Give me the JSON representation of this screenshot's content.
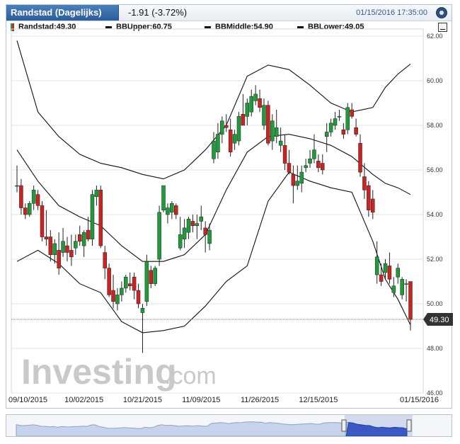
{
  "header": {
    "tab_title": "Randstad (Dagelijks)",
    "change": "-1.91 (-3.72%)",
    "timestamp": "01/15/2016 17:35:00"
  },
  "legend": {
    "symbol": "Randstad:49.30",
    "bb_upper": "BBUpper:60.75",
    "bb_middle": "BBMiddle:54.90",
    "bb_lower": "BBLower:49.05"
  },
  "watermark": {
    "brand": "Investing",
    "suffix": ".com"
  },
  "colors": {
    "up": "#1e9b3a",
    "down": "#cc2222",
    "band": "#111111",
    "price_tag": "#333333"
  },
  "chart_data": {
    "type": "candlestick",
    "title": "Randstad (Dagelijks)",
    "ylim": [
      46,
      62
    ],
    "yticks": [
      "46.00",
      "48.00",
      "50.00",
      "52.00",
      "54.00",
      "56.00",
      "58.00",
      "60.00",
      "62.00"
    ],
    "xtick_labels": [
      "09/10/2015",
      "10/02/2015",
      "10/21/2015",
      "11/09/2015",
      "11/26/2015",
      "12/15/2015",
      "01/15/2016"
    ],
    "xtick_index": [
      0,
      16,
      30,
      44,
      58,
      72,
      94
    ],
    "last_price": "49.30",
    "candles": [
      [
        55.3,
        56.2,
        55.0,
        55.3
      ],
      [
        55.3,
        55.6,
        54.0,
        54.3
      ],
      [
        54.3,
        54.5,
        53.8,
        54.0
      ],
      [
        54.0,
        54.6,
        53.9,
        54.5
      ],
      [
        54.5,
        55.3,
        54.2,
        55.1
      ],
      [
        54.9,
        55.1,
        54.2,
        54.4
      ],
      [
        54.4,
        54.6,
        52.8,
        53.0
      ],
      [
        53.0,
        54.2,
        52.6,
        52.9
      ],
      [
        53.0,
        53.3,
        51.9,
        52.2
      ],
      [
        52.2,
        52.9,
        51.8,
        52.7
      ],
      [
        52.4,
        53.2,
        51.3,
        51.6
      ],
      [
        52.3,
        53.4,
        52.1,
        52.8
      ],
      [
        52.6,
        53.0,
        51.9,
        52.3
      ],
      [
        52.4,
        53.1,
        51.7,
        52.1
      ],
      [
        52.5,
        53.1,
        52.2,
        52.8
      ],
      [
        53.1,
        53.5,
        52.6,
        52.8
      ],
      [
        52.6,
        53.3,
        52.1,
        53.2
      ],
      [
        53.3,
        53.9,
        52.8,
        52.9
      ],
      [
        52.9,
        55.1,
        52.6,
        54.9
      ],
      [
        54.8,
        55.3,
        54.4,
        55.1
      ],
      [
        55.1,
        55.3,
        52.5,
        52.6
      ],
      [
        52.3,
        52.6,
        51.1,
        51.6
      ],
      [
        51.6,
        51.8,
        50.3,
        50.4
      ],
      [
        50.6,
        51.3,
        49.8,
        50.1
      ],
      [
        50.0,
        50.7,
        49.7,
        50.4
      ],
      [
        50.4,
        51.0,
        50.1,
        50.7
      ],
      [
        50.7,
        51.3,
        50.5,
        51.2
      ],
      [
        50.9,
        51.4,
        50.6,
        50.8
      ],
      [
        51.2,
        51.4,
        50.2,
        50.6
      ],
      [
        50.6,
        50.9,
        49.8,
        50.0
      ],
      [
        49.6,
        50.0,
        47.8,
        49.8
      ],
      [
        50.1,
        52.2,
        49.9,
        51.9
      ],
      [
        51.5,
        51.7,
        50.7,
        50.9
      ],
      [
        50.9,
        51.7,
        50.8,
        51.6
      ],
      [
        52.0,
        54.4,
        51.7,
        54.1
      ],
      [
        54.2,
        55.3,
        54.1,
        55.3
      ],
      [
        54.0,
        54.5,
        53.6,
        54.3
      ],
      [
        54.1,
        54.6,
        53.8,
        54.5
      ],
      [
        54.4,
        54.5,
        53.8,
        54.0
      ],
      [
        52.5,
        53.9,
        52.4,
        53.1
      ],
      [
        52.9,
        53.8,
        52.5,
        53.4
      ],
      [
        53.2,
        53.9,
        52.9,
        53.8
      ],
      [
        53.7,
        54.0,
        53.2,
        53.5
      ],
      [
        53.5,
        54.0,
        52.9,
        53.6
      ],
      [
        53.7,
        54.4,
        53.3,
        53.9
      ],
      [
        53.4,
        53.7,
        52.3,
        53.1
      ],
      [
        52.7,
        53.6,
        52.4,
        53.3
      ],
      [
        56.5,
        57.7,
        56.3,
        57.3
      ],
      [
        56.8,
        58.1,
        56.5,
        57.6
      ],
      [
        57.6,
        58.4,
        57.2,
        58.2
      ],
      [
        58.0,
        58.5,
        57.7,
        57.9
      ],
      [
        57.8,
        58.3,
        56.6,
        56.8
      ],
      [
        57.2,
        57.8,
        56.9,
        57.6
      ],
      [
        57.3,
        58.6,
        57.1,
        58.4
      ],
      [
        58.5,
        59.4,
        58.2,
        58.0
      ],
      [
        58.4,
        59.2,
        58.0,
        59.0
      ],
      [
        58.6,
        59.6,
        58.4,
        59.3
      ],
      [
        59.1,
        59.8,
        58.9,
        59.4
      ],
      [
        59.2,
        59.6,
        58.6,
        58.8
      ],
      [
        58.0,
        59.2,
        57.8,
        58.9
      ],
      [
        58.9,
        59.1,
        57.1,
        57.2
      ],
      [
        57.3,
        58.5,
        56.9,
        58.2
      ],
      [
        57.5,
        58.7,
        57.2,
        57.9
      ],
      [
        57.1,
        57.9,
        56.8,
        57.3
      ],
      [
        57.1,
        57.6,
        56.0,
        56.3
      ],
      [
        56.3,
        56.9,
        55.8,
        55.9
      ],
      [
        55.8,
        56.2,
        54.5,
        55.3
      ],
      [
        55.3,
        56.2,
        55.1,
        55.5
      ],
      [
        55.4,
        56.2,
        55.0,
        55.9
      ],
      [
        56.1,
        56.5,
        55.9,
        56.2
      ],
      [
        56.3,
        56.9,
        56.1,
        56.5
      ],
      [
        56.5,
        57.6,
        56.3,
        56.9
      ],
      [
        56.4,
        56.7,
        55.9,
        56.1
      ],
      [
        56.3,
        56.7,
        55.8,
        56.0
      ],
      [
        57.5,
        58.1,
        56.8,
        57.7
      ],
      [
        57.7,
        58.3,
        57.5,
        58.1
      ],
      [
        58.0,
        58.6,
        57.8,
        58.3
      ],
      [
        58.4,
        58.7,
        58.2,
        58.4
      ],
      [
        57.8,
        58.1,
        57.4,
        57.6
      ],
      [
        57.8,
        59.0,
        57.6,
        58.8
      ],
      [
        58.7,
        59.0,
        58.3,
        58.4
      ],
      [
        57.9,
        58.3,
        57.5,
        57.6
      ],
      [
        57.2,
        57.6,
        55.7,
        55.9
      ],
      [
        55.7,
        56.3,
        54.7,
        55.1
      ],
      [
        55.3,
        55.5,
        53.9,
        54.2
      ],
      [
        54.7,
        55.1,
        53.8,
        54.1
      ],
      [
        51.3,
        52.8,
        50.9,
        52.1
      ],
      [
        51.3,
        51.8,
        50.8,
        51.0
      ],
      [
        51.4,
        52.0,
        51.1,
        51.8
      ],
      [
        51.7,
        52.3,
        50.9,
        51.1
      ],
      [
        50.5,
        51.2,
        50.3,
        50.8
      ],
      [
        51.2,
        51.8,
        50.9,
        51.6
      ],
      [
        50.4,
        51.2,
        50.2,
        51.1
      ],
      [
        50.9,
        51.1,
        50.1,
        50.9
      ],
      [
        51.0,
        51.0,
        48.8,
        49.3
      ]
    ],
    "bb_upper": [
      [
        0,
        61.8
      ],
      [
        5,
        58.6
      ],
      [
        10,
        57.5
      ],
      [
        15,
        56.7
      ],
      [
        20,
        56.3
      ],
      [
        25,
        56.1
      ],
      [
        30,
        55.8
      ],
      [
        35,
        55.6
      ],
      [
        40,
        56.0
      ],
      [
        45,
        56.9
      ],
      [
        50,
        58.0
      ],
      [
        55,
        60.2
      ],
      [
        60,
        60.7
      ],
      [
        65,
        60.5
      ],
      [
        70,
        59.8
      ],
      [
        75,
        59.0
      ],
      [
        80,
        58.6
      ],
      [
        85,
        58.8
      ],
      [
        88,
        59.7
      ],
      [
        91,
        60.3
      ],
      [
        94,
        60.75
      ]
    ],
    "bb_middle": [
      [
        0,
        56.9
      ],
      [
        5,
        55.5
      ],
      [
        10,
        54.4
      ],
      [
        15,
        53.9
      ],
      [
        20,
        53.5
      ],
      [
        25,
        52.6
      ],
      [
        30,
        51.9
      ],
      [
        35,
        51.9
      ],
      [
        40,
        52.2
      ],
      [
        45,
        53.1
      ],
      [
        50,
        55.1
      ],
      [
        55,
        56.8
      ],
      [
        60,
        57.5
      ],
      [
        65,
        57.6
      ],
      [
        70,
        57.4
      ],
      [
        75,
        57.1
      ],
      [
        80,
        56.6
      ],
      [
        85,
        55.8
      ],
      [
        88,
        55.4
      ],
      [
        91,
        55.2
      ],
      [
        94,
        54.9
      ]
    ],
    "bb_lower": [
      [
        0,
        51.9
      ],
      [
        5,
        52.4
      ],
      [
        10,
        51.8
      ],
      [
        15,
        50.9
      ],
      [
        20,
        50.5
      ],
      [
        25,
        49.2
      ],
      [
        30,
        48.7
      ],
      [
        35,
        48.8
      ],
      [
        40,
        49.0
      ],
      [
        45,
        49.9
      ],
      [
        50,
        51.0
      ],
      [
        55,
        51.7
      ],
      [
        60,
        54.6
      ],
      [
        65,
        55.9
      ],
      [
        70,
        55.5
      ],
      [
        75,
        55.2
      ],
      [
        80,
        55.0
      ],
      [
        85,
        52.8
      ],
      [
        88,
        51.1
      ],
      [
        91,
        50.2
      ],
      [
        94,
        49.05
      ]
    ]
  }
}
